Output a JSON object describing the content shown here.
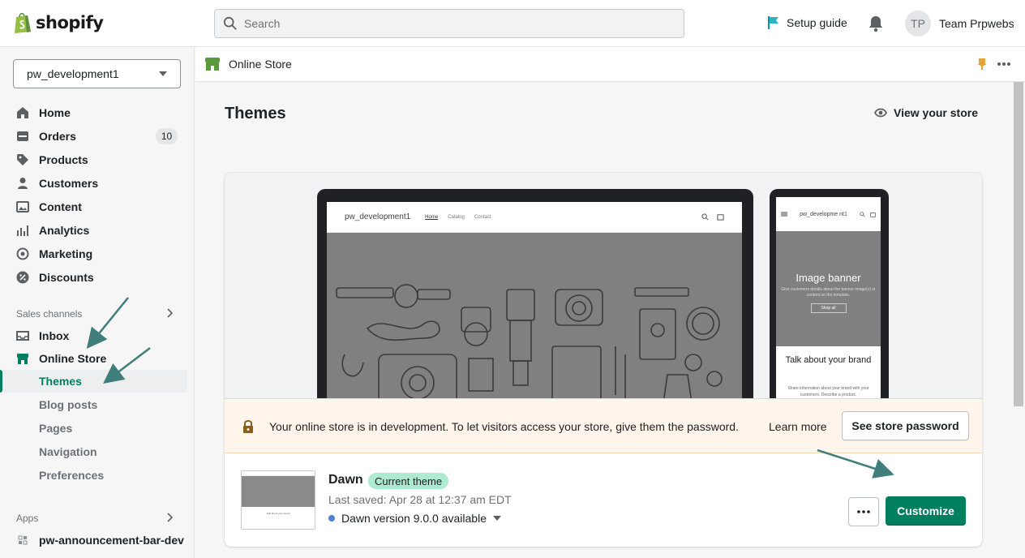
{
  "topbar": {
    "logo_text": "shopify",
    "search_placeholder": "Search",
    "setup_guide": "Setup guide",
    "user_initials": "TP",
    "user_name": "Team Prpwebs"
  },
  "sidebar": {
    "store_name": "pw_development1",
    "items": [
      {
        "label": "Home",
        "icon": "home-icon"
      },
      {
        "label": "Orders",
        "icon": "orders-icon",
        "badge": "10"
      },
      {
        "label": "Products",
        "icon": "tag-icon"
      },
      {
        "label": "Customers",
        "icon": "person-icon"
      },
      {
        "label": "Content",
        "icon": "image-icon"
      },
      {
        "label": "Analytics",
        "icon": "bar-chart-icon"
      },
      {
        "label": "Marketing",
        "icon": "target-icon"
      },
      {
        "label": "Discounts",
        "icon": "discount-icon"
      }
    ],
    "sales_channels_label": "Sales channels",
    "channels": [
      {
        "label": "Inbox",
        "icon": "inbox-icon"
      },
      {
        "label": "Online Store",
        "icon": "store-icon"
      }
    ],
    "online_store_subitems": [
      "Themes",
      "Blog posts",
      "Pages",
      "Navigation",
      "Preferences"
    ],
    "apps_label": "Apps",
    "apps": [
      {
        "label": "pw-announcement-bar-dev",
        "icon": "app-icon"
      }
    ]
  },
  "subheader": {
    "title": "Online Store"
  },
  "main": {
    "page_title": "Themes",
    "view_store": "View your store",
    "preview": {
      "laptop_store_name": "pw_development1",
      "laptop_links": [
        "Home",
        "Catalog",
        "Contact"
      ],
      "phone_store_name": "pw_developme nt1",
      "phone_banner_title": "Image banner",
      "phone_banner_sub": "Give customers details about the banner image(s) or content on the template.",
      "phone_banner_button": "Shop all",
      "phone_talk_title": "Talk about your brand",
      "phone_talk_sub": "Share information about your brand with your customers. Describe a product."
    },
    "banner": {
      "message": "Your online store is in development. To let visitors access your store, give them the password.",
      "learn_more": "Learn more",
      "see_password": "See store password"
    },
    "theme": {
      "name": "Dawn",
      "badge": "Current theme",
      "last_saved": "Last saved: Apr 28 at 12:37 am EDT",
      "version": "Dawn version 9.0.0 available",
      "customize": "Customize"
    }
  },
  "colors": {
    "brand_green": "#007f5f",
    "badge_green": "#aee9d1",
    "warning_bg": "#fff5ea",
    "annotation_arrow": "#3f7e7a"
  }
}
